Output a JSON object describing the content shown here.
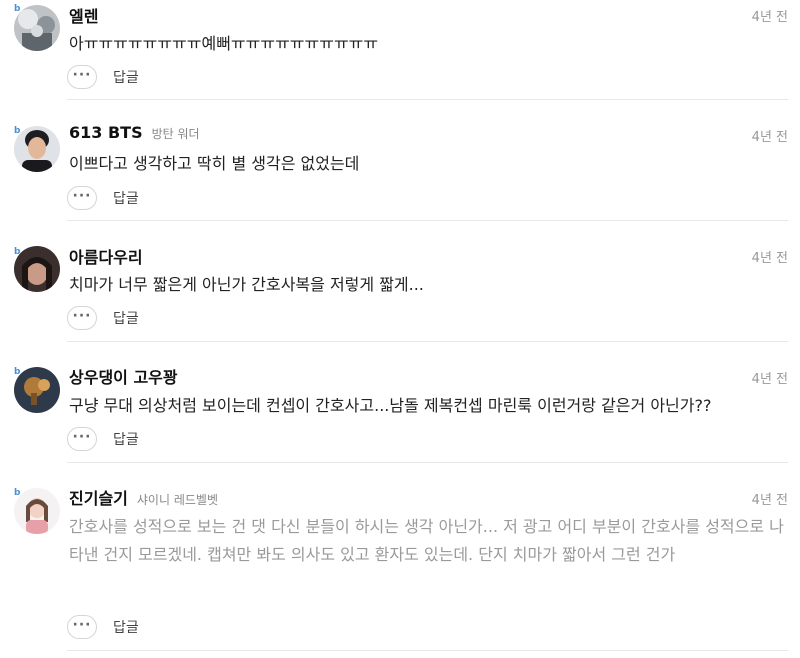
{
  "comments": [
    {
      "badge": "b",
      "username": "엘렌",
      "fan": "",
      "time": "4년 전",
      "text": "아ㅠㅠㅠㅠㅠㅠㅠㅠ예뻐ㅠㅠㅠㅠㅠㅠㅠㅠㅠㅠ",
      "faded": false,
      "more_label": "···",
      "reply_label": "답글"
    },
    {
      "badge": "b",
      "username": "613 BTS",
      "fan": "방탄 워더",
      "time": "4년 전",
      "text": "이쁘다고 생각하고 딱히 별 생각은 없었는데",
      "faded": false,
      "more_label": "···",
      "reply_label": "답글"
    },
    {
      "badge": "b",
      "username": "아름다우리",
      "fan": "",
      "time": "4년 전",
      "text": "치마가 너무 짧은게 아닌가 간호사복을 저렇게 짧게...",
      "faded": false,
      "more_label": "···",
      "reply_label": "답글"
    },
    {
      "badge": "b",
      "username": "상우댕이 고우꽝",
      "fan": "",
      "time": "4년 전",
      "text": "구냥 무대 의상처럼 보이는데 컨셉이 간호사고...남돌 제복컨셉 마린룩 이런거랑 같은거 아닌가??",
      "faded": false,
      "more_label": "···",
      "reply_label": "답글"
    },
    {
      "badge": "b",
      "username": "진기슬기",
      "fan": "샤이니 레드벨벳",
      "time": "4년 전",
      "text": "간호사를 성적으로 보는 건 댓 다신 분들이 하시는 생각 아닌가... 저 광고 어디 부분이 간호사를 성적으로 나타낸 건지 모르겠네. 캡쳐만 봐도 의사도 있고 환자도 있는데. 단지 치마가 짧아서 그런 건가",
      "faded": true,
      "more_label": "···",
      "reply_label": "답글"
    }
  ]
}
